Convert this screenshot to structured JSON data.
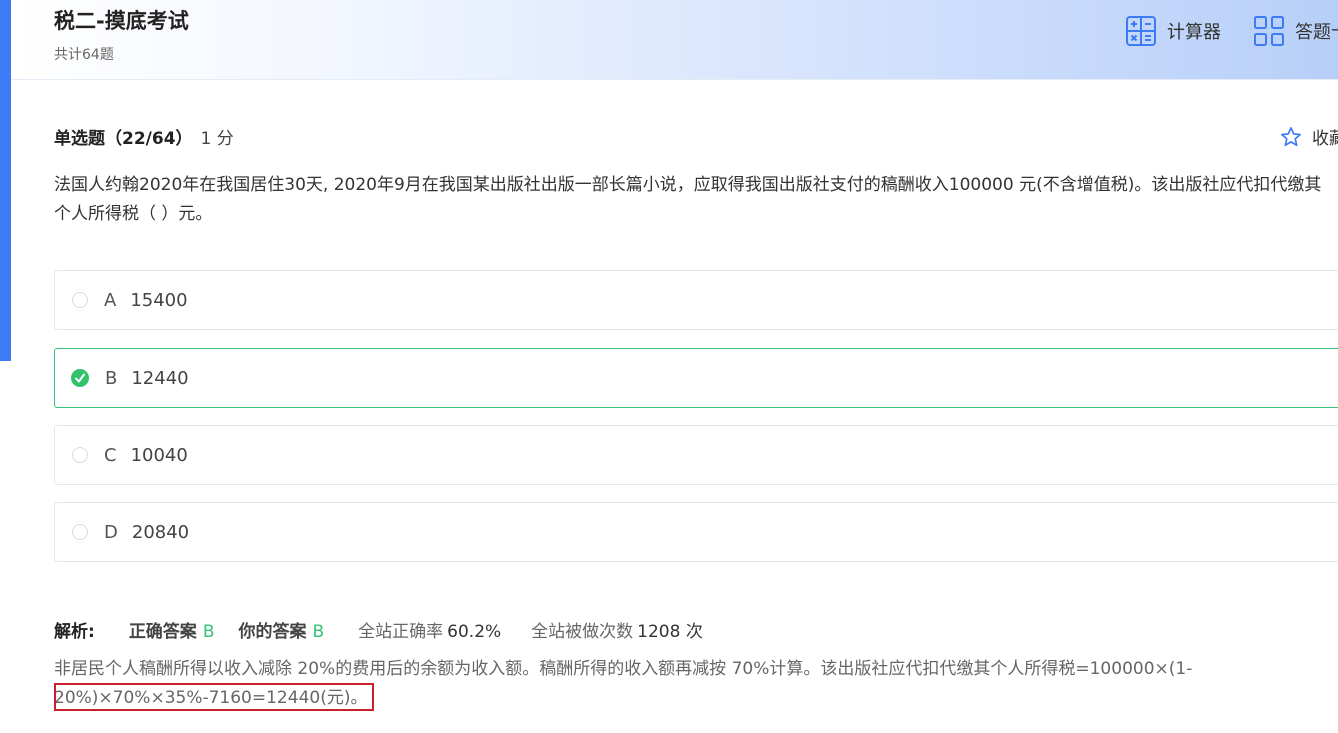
{
  "header": {
    "title": "税二-摸底考试",
    "question_count": "共计64题",
    "calculator_label": "计算器",
    "answer_sheet_label": "答题卡"
  },
  "question": {
    "type_label": "单选题（22/64）",
    "score": "1 分",
    "favorite_label": "收藏",
    "text": "法国人约翰2020年在我国居住30天, 2020年9月在我国某出版社出版一部长篇小说，应取得我国出版社支付的稿酬收入100000 元(不含增值税)。该出版社应代扣代缴其个人所得税（    ）元。"
  },
  "options": [
    {
      "letter": "A",
      "value": "15400",
      "selected": false
    },
    {
      "letter": "B",
      "value": "12440",
      "selected": true
    },
    {
      "letter": "C",
      "value": "10040",
      "selected": false
    },
    {
      "letter": "D",
      "value": "20840",
      "selected": false
    }
  ],
  "analysis": {
    "label": "解析:",
    "correct_label": "正确答案",
    "correct_value": "B",
    "yours_label": "你的答案",
    "yours_value": "B",
    "rate_label": "全站正确率",
    "rate_value": "60.2%",
    "count_label": "全站被做次数",
    "count_value": "1208 次",
    "text": "非居民个人稿酬所得以收入减除 20%的费用后的余额为收入额。稿酬所得的收入额再减按 70%计算。该出版社应代扣代缴其个人所得税=100000×(1-20%)×70%×35%-7160=12440(元)。"
  },
  "colors": {
    "accent": "#3e7bf6",
    "correct_green": "#33c374",
    "selected_border": "#39c37b",
    "highlight_red": "#cc1f2e"
  },
  "icons": {
    "calculator": "calculator-icon",
    "answer_sheet": "grid-icon",
    "favorite": "star-icon",
    "check": "check-icon"
  }
}
